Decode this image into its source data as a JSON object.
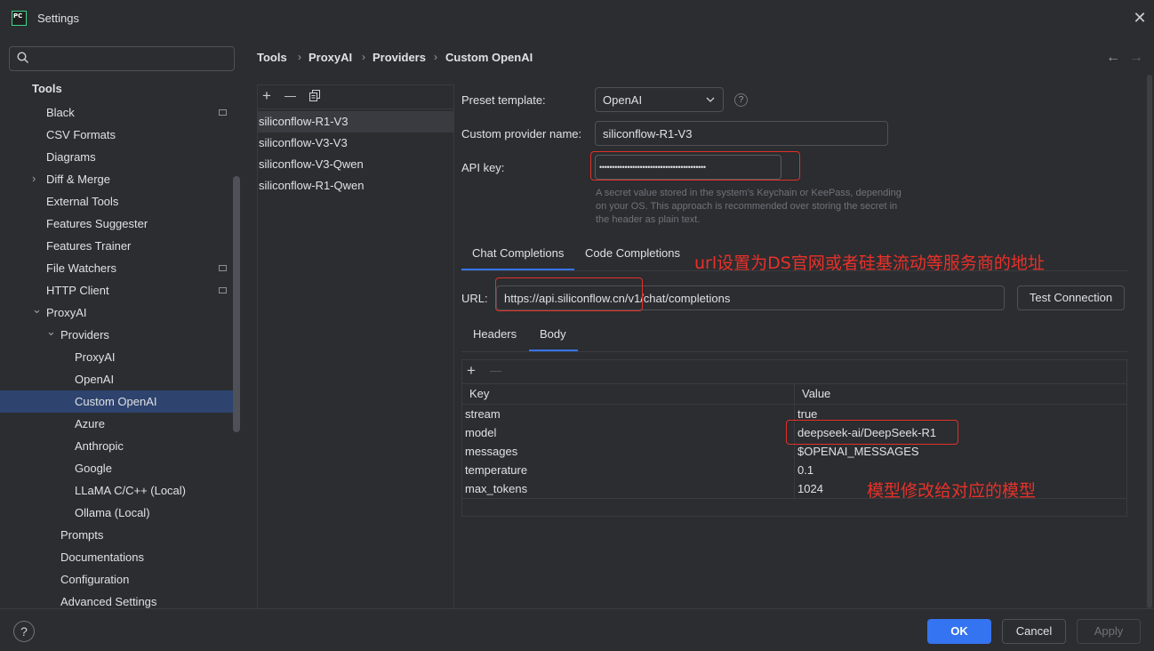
{
  "window": {
    "title": "Settings",
    "app_icon_text": "PC",
    "close_glyph": "✕"
  },
  "sidebar": {
    "section_title": "Tools",
    "items": [
      {
        "label": "Black",
        "level": 1,
        "pinned": true
      },
      {
        "label": "CSV Formats",
        "level": 1
      },
      {
        "label": "Diagrams",
        "level": 1
      },
      {
        "label": "Diff & Merge",
        "level": 1,
        "expandable": true
      },
      {
        "label": "External Tools",
        "level": 1
      },
      {
        "label": "Features Suggester",
        "level": 1
      },
      {
        "label": "Features Trainer",
        "level": 1
      },
      {
        "label": "File Watchers",
        "level": 1,
        "pinned": true
      },
      {
        "label": "HTTP Client",
        "level": 1,
        "pinned": true
      },
      {
        "label": "ProxyAI",
        "level": 1,
        "expanded": true
      },
      {
        "label": "Providers",
        "level": 2,
        "expanded": true
      },
      {
        "label": "ProxyAI",
        "level": 3
      },
      {
        "label": "OpenAI",
        "level": 3
      },
      {
        "label": "Custom OpenAI",
        "level": 3,
        "selected": true
      },
      {
        "label": "Azure",
        "level": 3
      },
      {
        "label": "Anthropic",
        "level": 3
      },
      {
        "label": "Google",
        "level": 3
      },
      {
        "label": "LLaMA C/C++ (Local)",
        "level": 3
      },
      {
        "label": "Ollama (Local)",
        "level": 3
      },
      {
        "label": "Prompts",
        "level": 2
      },
      {
        "label": "Documentations",
        "level": 2
      },
      {
        "label": "Configuration",
        "level": 2
      },
      {
        "label": "Advanced Settings",
        "level": 2
      }
    ]
  },
  "breadcrumb": [
    "Tools",
    "ProxyAI",
    "Providers",
    "Custom OpenAI"
  ],
  "nav": {
    "back": "←",
    "forward": "→"
  },
  "provider_list": {
    "items": [
      "siliconflow-R1-V3",
      "siliconflow-V3-V3",
      "siliconflow-V3-Qwen",
      "siliconflow-R1-Qwen"
    ],
    "add": "+",
    "remove": "—"
  },
  "form": {
    "preset_label": "Preset template:",
    "preset_value": "OpenAI",
    "help_glyph": "?",
    "name_label": "Custom provider name:",
    "name_value": "siliconflow-R1-V3",
    "api_key_label": "API key:",
    "api_key_value": "••••••••••••••••••••••••••••••••••••••••••",
    "api_key_hint_1": "A secret value stored in the system's Keychain or KeePass, depending",
    "api_key_hint_2": "on your OS. This approach is recommended over storing the secret in",
    "api_key_hint_3": "the header as plain text.",
    "tabs": [
      "Chat Completions",
      "Code Completions"
    ],
    "url_label": "URL:",
    "url_value": "https://api.siliconflow.cn/v1/chat/completions",
    "test_button": "Test Connection",
    "subtabs": [
      "Headers",
      "Body"
    ],
    "table": {
      "headers": [
        "Key",
        "Value"
      ],
      "rows": [
        {
          "key": "stream",
          "value": "true"
        },
        {
          "key": "model",
          "value": "deepseek-ai/DeepSeek-R1"
        },
        {
          "key": "messages",
          "value": "$OPENAI_MESSAGES"
        },
        {
          "key": "temperature",
          "value": "0.1"
        },
        {
          "key": "max_tokens",
          "value": "1024"
        }
      ]
    }
  },
  "annotations": {
    "url_note": "url设置为DS官网或者硅基流动等服务商的地址",
    "model_note": "模型修改给对应的模型"
  },
  "footer": {
    "help": "?",
    "ok": "OK",
    "cancel": "Cancel",
    "apply": "Apply"
  },
  "colors": {
    "accent": "#3574f0",
    "annotation": "#e8312a",
    "background": "#2b2d30",
    "selection": "#2e436e"
  }
}
